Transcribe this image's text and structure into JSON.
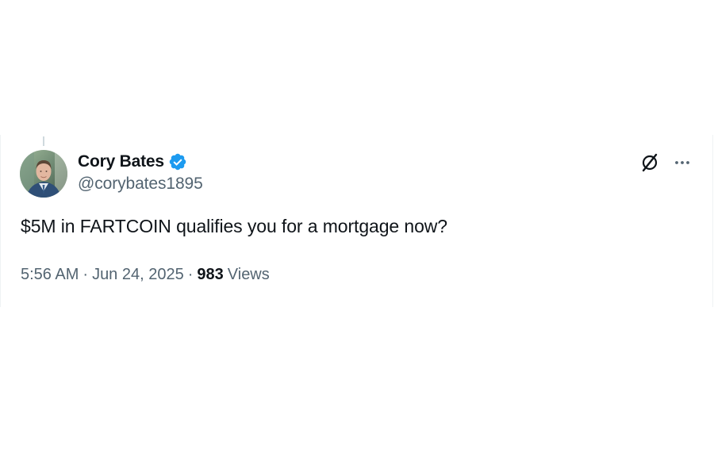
{
  "tweet": {
    "author": {
      "display_name": "Cory Bates",
      "handle": "@corybates1895",
      "verified": true,
      "avatar_icon": "profile-photo"
    },
    "text": "$5M in FARTCOIN qualifies you for a mortgage now?",
    "meta": {
      "time": "5:56 AM",
      "separator": "·",
      "date": "Jun 24, 2025",
      "views_count": "983",
      "views_label": "Views"
    },
    "actions": {
      "grok_icon": "grok-icon",
      "more_icon": "more-options-icon"
    }
  },
  "colors": {
    "text_primary": "#0f1419",
    "text_secondary": "#536471",
    "verified_blue": "#1d9bf0",
    "border": "#eff3f4"
  }
}
